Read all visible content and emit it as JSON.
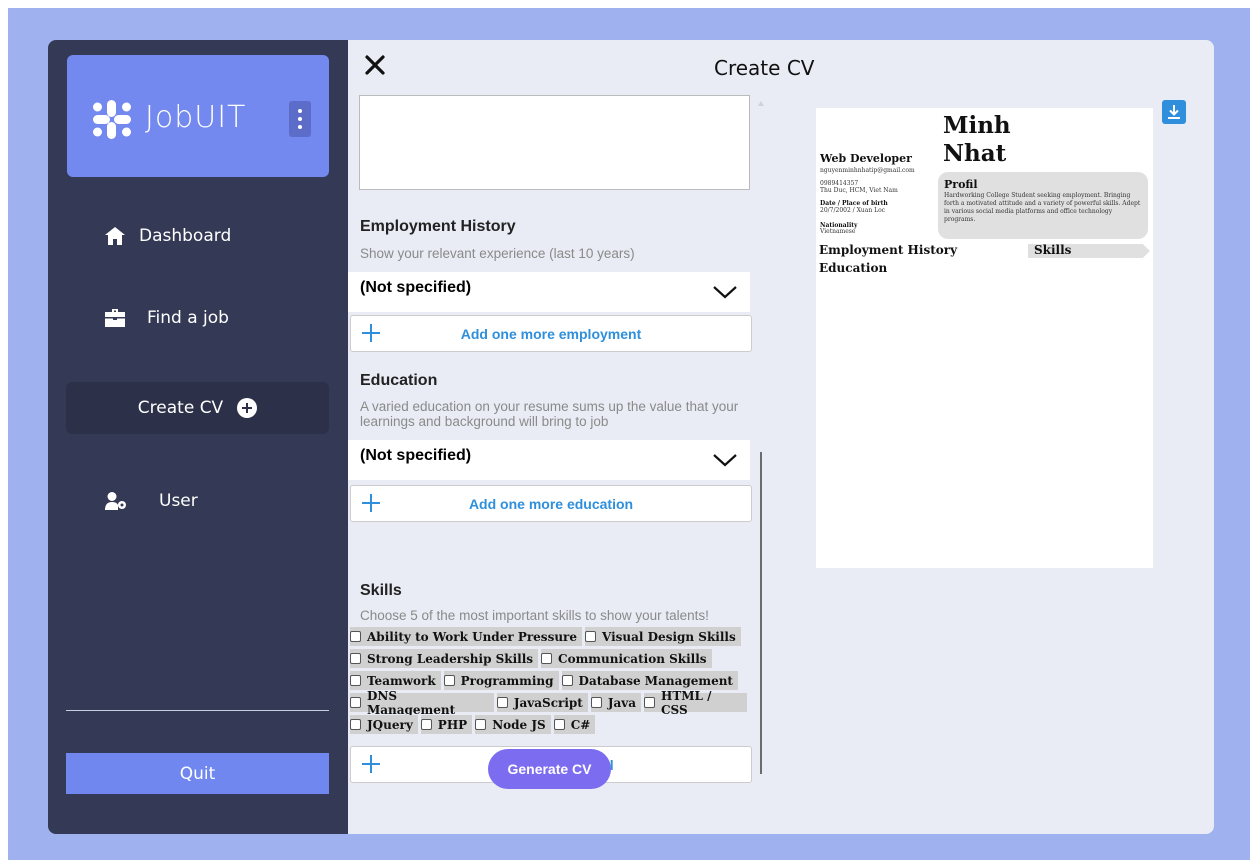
{
  "app": {
    "name": "JobUIT"
  },
  "sidebar": {
    "items": [
      {
        "label": "Dashboard",
        "icon": "home-icon"
      },
      {
        "label": "Find a job",
        "icon": "briefcase-icon"
      },
      {
        "label": "Create CV",
        "icon": "plus-circle-icon",
        "active": true
      },
      {
        "label": "User",
        "icon": "user-gear-icon"
      }
    ],
    "quit_label": "Quit"
  },
  "dialog": {
    "title": "Create CV"
  },
  "form": {
    "employment": {
      "title": "Employment History",
      "subtitle": "Show your relevant experience (last 10 years)",
      "entry_label": "(Not specified)",
      "add_label": "Add one more employment"
    },
    "education": {
      "title": "Education",
      "subtitle": "A varied education on your resume sums up the value that your learnings and background will bring to job",
      "entry_label": "(Not specified)",
      "add_label": "Add one more education"
    },
    "skills": {
      "title": "Skills",
      "subtitle": "Choose 5 of the most important skills to show your talents!",
      "rows": [
        [
          "Ability to Work Under Pressure",
          "Visual Design Skills"
        ],
        [
          "Strong Leadership Skills",
          "Communication Skills"
        ],
        [
          "Teamwork",
          "Programming",
          "Database Management"
        ],
        [
          "DNS Management",
          "JavaScript",
          "Java",
          "HTML / CSS"
        ],
        [
          "JQuery",
          "PHP",
          "Node JS",
          "C#"
        ]
      ],
      "add_label": "Add one more skill"
    },
    "generate_label": "Generate CV"
  },
  "preview": {
    "first_name": "Minh",
    "last_name": "Nhat",
    "job_title": "Web Developer",
    "email": "nguyenminhnhatip@gmail.com",
    "phone": "0989414357",
    "address": "Thu Duc, HCM, Viet Nam",
    "dob_label": "Date / Place of birth",
    "dob_value": "20/7/2002 / Xuan Loc",
    "nationality_label": "Nationality",
    "nationality_value": "Vietnamese",
    "profil_title": "Profil",
    "profil_text": "Hardworking College Student seeking employment. Bringing forth a motivated attitude and a variety of powerful skills. Adept in various social media platforms and office technology programs.",
    "employment_heading": "Employment History",
    "education_heading": "Education",
    "skills_heading": "Skills"
  },
  "colors": {
    "sidebar_bg": "#343a55",
    "accent": "#7489ef",
    "link_blue": "#2f8fdc",
    "generate_purple": "#7c6cf0",
    "backdrop": "#9fb1ee"
  }
}
